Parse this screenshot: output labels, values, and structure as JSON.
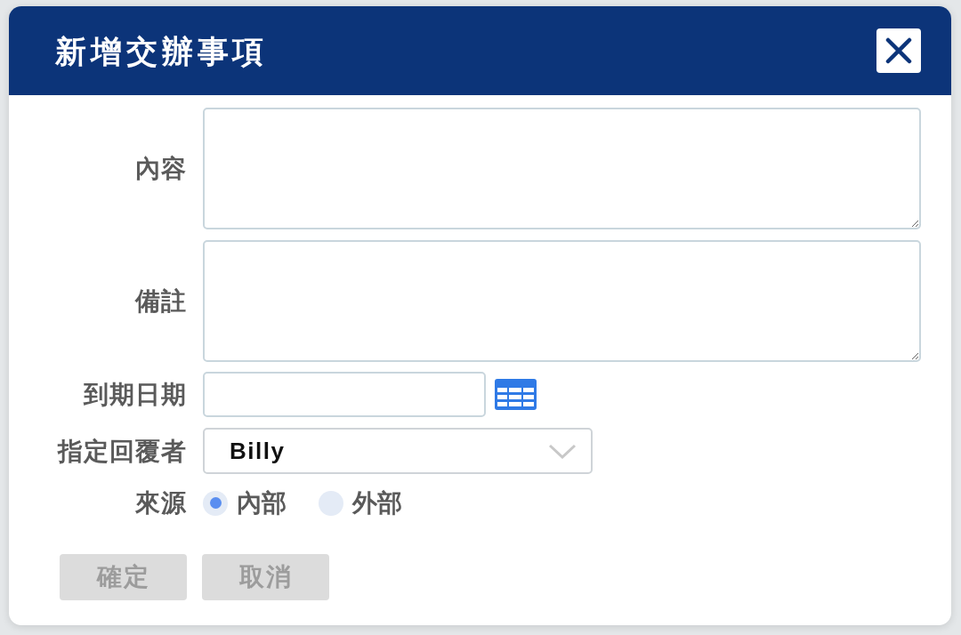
{
  "dialog": {
    "title": "新增交辦事項"
  },
  "fields": [
    {
      "kind": "textarea",
      "label": "內容"
    },
    {
      "kind": "textarea",
      "label": "備註"
    },
    {
      "kind": "date",
      "label": "到期日期"
    },
    {
      "kind": "select",
      "label": "指定回覆者",
      "value": "Billy"
    },
    {
      "kind": "radio",
      "label": "來源",
      "options": [
        {
          "label": "內部",
          "selected": true
        },
        {
          "label": "外部",
          "selected": false
        }
      ]
    }
  ],
  "buttons": [
    {
      "label": "確定",
      "disabled": true
    },
    {
      "label": "取消",
      "disabled": true
    }
  ]
}
